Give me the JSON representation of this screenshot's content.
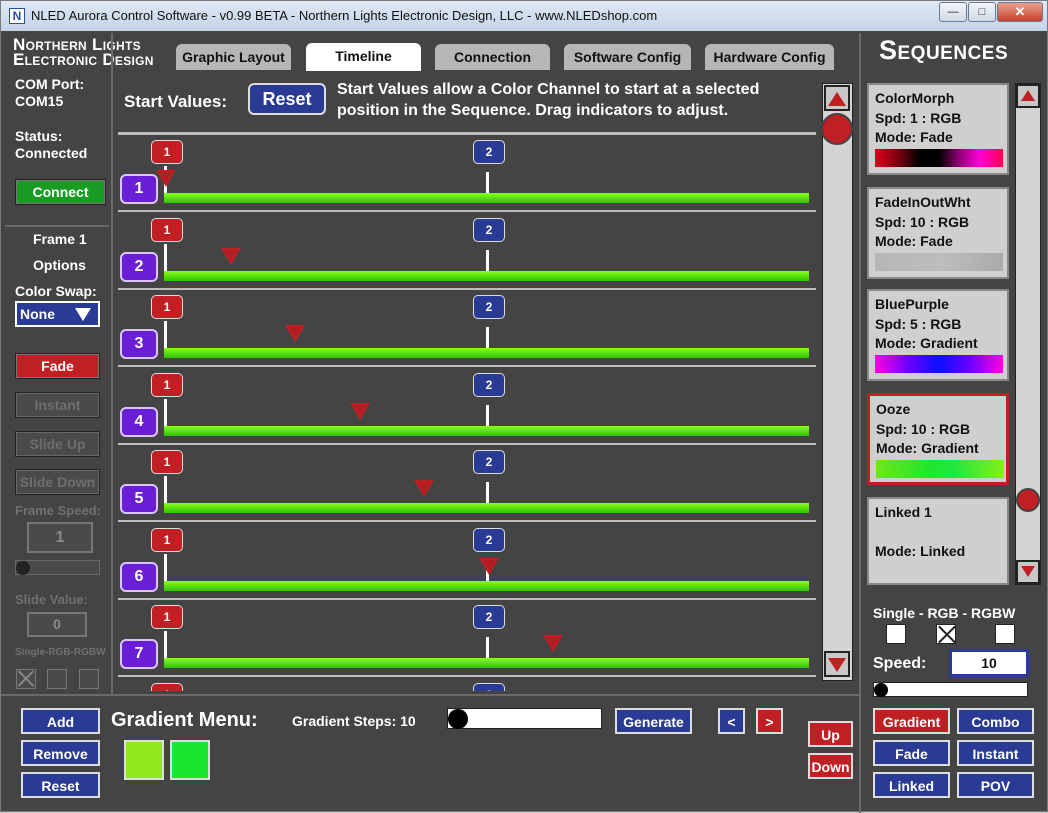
{
  "window": {
    "title": "NLED Aurora Control Software - v0.99 BETA - Northern Lights Electronic Design, LLC - www.NLEDshop.com",
    "app_icon": "N",
    "minimize": "—",
    "maximize": "□",
    "close": "✕"
  },
  "logo": {
    "line1": "Northern Lights",
    "line2": "Electronic Design"
  },
  "tabs": [
    {
      "label": "Graphic Layout"
    },
    {
      "label": "Timeline",
      "active": true
    },
    {
      "label": "Connection"
    },
    {
      "label": "Software Config"
    },
    {
      "label": "Hardware Config"
    }
  ],
  "sequences_title": "Sequences",
  "left": {
    "com_label": "COM Port:",
    "com_value": "COM15",
    "status_label": "Status:",
    "status_value": "Connected",
    "connect_label": "Connect",
    "frame_label": "Frame 1",
    "options_label": "Options",
    "color_swap_label": "Color Swap:",
    "color_swap_value": "None",
    "fade_label": "Fade",
    "instant_label": "Instant",
    "slide_up_label": "Slide Up",
    "slide_down_label": "Slide Down",
    "frame_speed_label": "Frame Speed:",
    "frame_speed_value": "1",
    "frame_speed_fraction": 0.0,
    "slide_value_label": "Slide Value:",
    "slide_value": "0",
    "mode_label": "Single-RGB-RGBW"
  },
  "timeline": {
    "start_values_label": "Start Values:",
    "reset_label": "Reset",
    "info_line1": "Start Values allow a Color Channel to start at a selected",
    "info_line2": "position in the Sequence. Drag indicators to adjust.",
    "marker1": "1",
    "marker2": "2",
    "channels": [
      {
        "num": "1",
        "start_fraction": 0.0
      },
      {
        "num": "2",
        "start_fraction": 0.1
      },
      {
        "num": "3",
        "start_fraction": 0.2
      },
      {
        "num": "4",
        "start_fraction": 0.3
      },
      {
        "num": "5",
        "start_fraction": 0.4
      },
      {
        "num": "6",
        "start_fraction": 0.5
      },
      {
        "num": "7",
        "start_fraction": 0.6
      }
    ]
  },
  "gradient_menu": {
    "add_label": "Add",
    "remove_label": "Remove",
    "reset_label": "Reset",
    "title": "Gradient Menu:",
    "steps_label": "Gradient Steps: 10",
    "steps_fraction": 0.0,
    "generate_label": "Generate",
    "prev_label": "<",
    "next_label": ">",
    "up_label": "Up",
    "down_label": "Down",
    "swatch1_color": "#8ee81a",
    "swatch2_color": "#19e62e"
  },
  "sequences": [
    {
      "name": "ColorMorph",
      "speed": "Spd: 1 : RGB",
      "mode": "Mode: Fade",
      "gradient": "linear-gradient(90deg,#e0001a 0%,#7a0010 18%,#000 35%,#000 50%,#8a0070 65%,#ff00d8 82%,#ff0050 100%)"
    },
    {
      "name": "FadeInOutWht",
      "speed": "Spd: 10 : RGB",
      "mode": "Mode: Fade",
      "gradient": "linear-gradient(90deg,#b6b6b6,#bdbdbd,#aaaaaa)"
    },
    {
      "name": "BluePurple",
      "speed": "Spd: 5 : RGB",
      "mode": "Mode: Gradient",
      "gradient": "linear-gradient(90deg,#ff00e0 0%,#7000ff 25%,#0a10ff 50%,#7000ff 75%,#ff00e0 100%)"
    },
    {
      "name": "Ooze",
      "speed": "Spd: 10 : RGB",
      "mode": "Mode: Gradient",
      "gradient": "linear-gradient(90deg,#6ee61a 0%,#22e62a 40%,#1ee640 60%,#84f018 100%)",
      "selected": true
    },
    {
      "name": "Linked 1",
      "speed": "",
      "mode": "Mode: Linked"
    }
  ],
  "right": {
    "mode_label": "Single - RGB - RGBW",
    "speed_label": "Speed:",
    "speed_value": "10",
    "speed_fraction": 0.0,
    "gradient_label": "Gradient",
    "combo_label": "Combo",
    "fade_label": "Fade",
    "instant_label": "Instant",
    "linked_label": "Linked",
    "pov_label": "POV"
  },
  "icons": {
    "scroll_up": "scroll-up-arrow-icon",
    "scroll_down": "scroll-down-arrow-icon",
    "dropdown": "triangle-down-icon",
    "marker": "start-value-indicator-icon"
  },
  "colors": {
    "accent_red": "#c01f24",
    "accent_blue": "#2a3b95",
    "accent_green": "#1a9c24",
    "channel_purple": "#6a1fd6",
    "bar_green": "#58e012"
  }
}
